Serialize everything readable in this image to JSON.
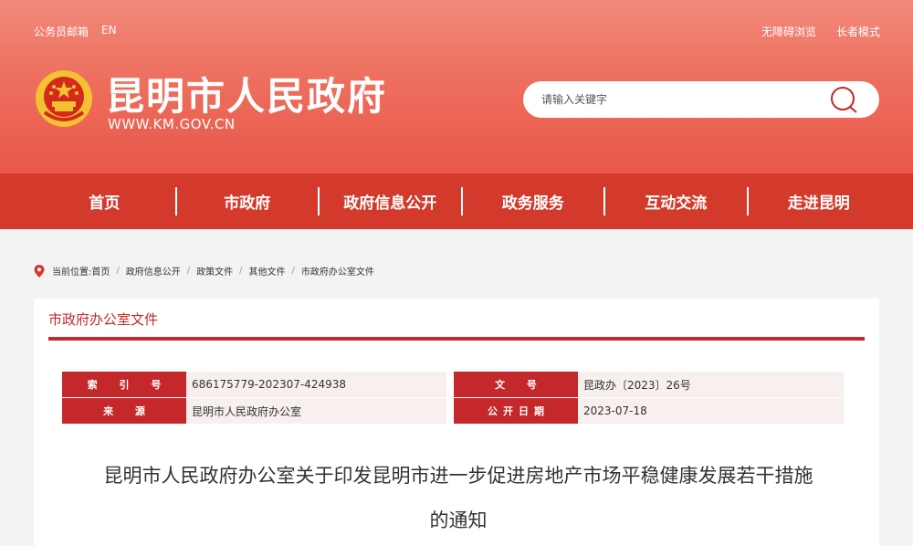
{
  "topbar": {
    "left": [
      "公务员邮箱",
      "EN"
    ],
    "right": [
      "无障碍浏览",
      "长者模式"
    ]
  },
  "site": {
    "title": "昆明市人民政府",
    "url": "WWW.KM.GOV.CN",
    "emblem_icon": "national-emblem-icon"
  },
  "search": {
    "placeholder": "请输入关键字",
    "icon": "search-icon"
  },
  "nav": {
    "items": [
      "首页",
      "市政府",
      "政府信息公开",
      "政务服务",
      "互动交流",
      "走进昆明"
    ]
  },
  "breadcrumb": {
    "prefix": "当前位置:",
    "items": [
      "首页",
      "政府信息公开",
      "政策文件",
      "其他文件",
      "市政府办公室文件"
    ]
  },
  "panel": {
    "title": "市政府办公室文件"
  },
  "meta": {
    "index_label": "索 引 号",
    "index_value": "686175779-202307-424938",
    "docno_label": "文 号",
    "docno_value": "昆政办〔2023〕26号",
    "source_label": "来 源",
    "source_value": "昆明市人民政府办公室",
    "date_label": "公开日期",
    "date_value": "2023-07-18"
  },
  "document": {
    "title_line1": "昆明市人民政府办公室关于印发昆明市进一步促进房地产市场平稳健康发展若干措施",
    "title_line2": "的通知"
  },
  "colors": {
    "header_top": "#f08a7a",
    "header_bottom": "#e85848",
    "nav_bg": "#d33a2c",
    "accent_red": "#c4282a",
    "meta_value_bg": "#f7f0ef"
  }
}
